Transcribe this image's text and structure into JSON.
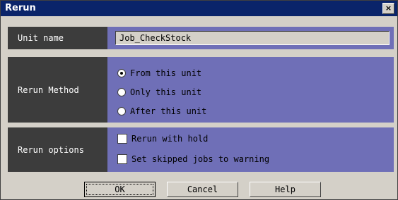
{
  "window": {
    "title": "Rerun",
    "close_glyph": "×"
  },
  "unit": {
    "label": "Unit name",
    "value": "Job_CheckStock"
  },
  "method": {
    "label": "Rerun Method",
    "options": [
      {
        "label": "From this unit",
        "selected": true
      },
      {
        "label": "Only this unit",
        "selected": false
      },
      {
        "label": "After this unit",
        "selected": false
      }
    ]
  },
  "rerun_options": {
    "label": "Rerun options",
    "items": [
      {
        "label": "Rerun with hold",
        "checked": false
      },
      {
        "label": "Set skipped jobs to warning",
        "checked": false
      }
    ]
  },
  "buttons": {
    "ok": "OK",
    "cancel": "Cancel",
    "help": "Help"
  },
  "colors": {
    "title_bar": "#0a246a",
    "panel": "#6f6fb7",
    "label_cell": "#3c3c3c",
    "window_bg": "#d4d0c8"
  }
}
